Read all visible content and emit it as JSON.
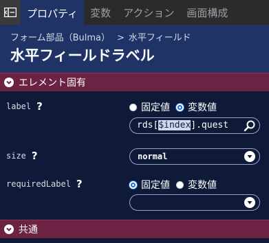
{
  "tabs": [
    {
      "label": "プロパティ",
      "active": true
    },
    {
      "label": "変数",
      "active": false
    },
    {
      "label": "アクション",
      "active": false
    },
    {
      "label": "画面構成",
      "active": false
    }
  ],
  "header": {
    "breadcrumb_parent": "フォーム部品（Bulma）",
    "breadcrumb_separator": ">",
    "breadcrumb_current": "水平フィールド",
    "title": "水平フィールドラベル"
  },
  "sections": {
    "element": {
      "label": "エレメント固有",
      "expanded": true
    },
    "common": {
      "label": "共通",
      "expanded": true
    }
  },
  "properties": {
    "label": {
      "name": "label",
      "help": "?",
      "radio_fixed": "固定値",
      "radio_variable": "変数値",
      "selected": "variable",
      "value_prefix": "rds[",
      "value_highlight": "$index",
      "value_suffix": "].quest"
    },
    "size": {
      "name": "size",
      "help": "?",
      "value": "normal"
    },
    "requiredLabel": {
      "name": "requiredLabel",
      "help": "?",
      "radio_fixed": "固定値",
      "radio_variable": "変数値",
      "selected": "fixed",
      "value": ""
    }
  },
  "icons": {
    "collapse": "panel-collapse-icon",
    "search": "search-icon",
    "dropdown": "chevron-down-icon"
  },
  "colors": {
    "background": "#0e1a38",
    "header": "#1f3366",
    "section": "#6b2243",
    "radio_checked": "#1f6fd6"
  }
}
